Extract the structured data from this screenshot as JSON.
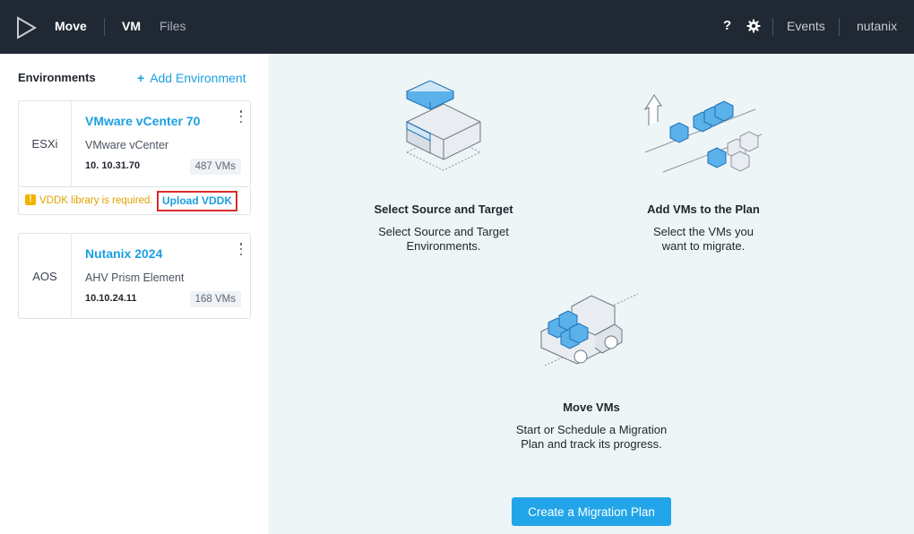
{
  "header": {
    "logo_icon": "play-logo-icon",
    "app_name": "Move",
    "nav": {
      "vm": "VM",
      "files": "Files"
    },
    "help": "?",
    "settings_icon": "gear-icon",
    "events": "Events",
    "user": "nutanix"
  },
  "sidebar": {
    "title": "Environments",
    "add_label": "Add Environment",
    "add_icon": "+",
    "environments": [
      {
        "type": "ESXi",
        "name": "VMware vCenter 70",
        "platform": "VMware vCenter",
        "ip": "10. 10.31.70",
        "vm_count": "487 VMs"
      },
      {
        "type": "AOS",
        "name": "Nutanix 2024",
        "platform": "AHV Prism Element",
        "ip": "10.10.24.11",
        "vm_count": "168 VMs"
      }
    ],
    "warning": {
      "icon": "!",
      "text": "VDDK library is required.",
      "link": "Upload VDDK"
    }
  },
  "main": {
    "steps": [
      {
        "title": "Select Source and Target",
        "desc1": "Select Source and Target",
        "desc2": "Environments."
      },
      {
        "title": "Add VMs to the Plan",
        "desc1": "Select the VMs you",
        "desc2": "want to migrate."
      },
      {
        "title": "Move VMs",
        "desc1": "Start or Schedule a Migration",
        "desc2": "Plan and track its progress."
      }
    ],
    "create_button": "Create a Migration Plan"
  },
  "colors": {
    "header_bg": "#202833",
    "accent": "#1b9fe0",
    "warning": "#e0a100",
    "main_bg": "#edf5f7"
  }
}
